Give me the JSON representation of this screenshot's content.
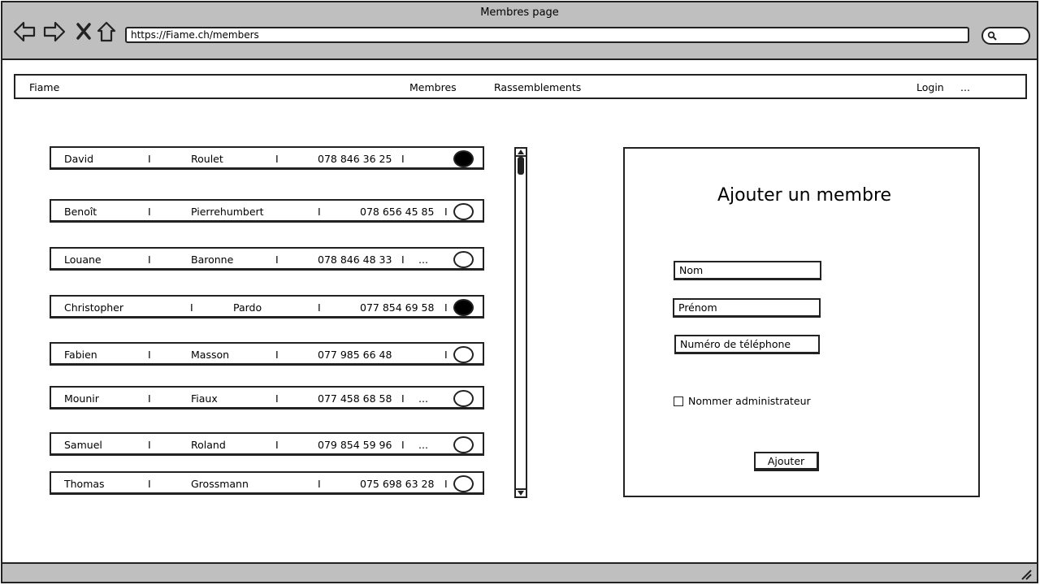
{
  "window": {
    "title": "Membres page"
  },
  "browser": {
    "back_icon": "back-arrow-icon",
    "forward_icon": "forward-arrow-icon",
    "stop_icon": "close-x-icon",
    "home_icon": "home-icon",
    "url": "https://Fiame.ch/members",
    "search_icon": "search-icon"
  },
  "menu": {
    "brand": "Fiame",
    "members": "Membres",
    "gatherings": "Rassemblements",
    "login": "Login",
    "more": "..."
  },
  "members": [
    {
      "first": "David",
      "last": "Roulet",
      "phone": "078 846 36 25",
      "extra": "",
      "admin": true
    },
    {
      "first": "Benoît",
      "last": "Pierrehumbert",
      "phone": "078 656 45 85",
      "extra": "",
      "admin": false
    },
    {
      "first": "Louane",
      "last": "Baronne",
      "phone": "078 846 48 33",
      "extra": "...",
      "admin": false
    },
    {
      "first": "Christopher",
      "last": "Pardo",
      "phone": "077 854 69 58",
      "extra": "",
      "admin": true
    },
    {
      "first": "Fabien",
      "last": "Masson",
      "phone": "077 985 66 48",
      "extra": "",
      "admin": false
    },
    {
      "first": "Mounir",
      "last": "Fiaux",
      "phone": "077 458 68 58",
      "extra": "...",
      "admin": false
    },
    {
      "first": "Samuel",
      "last": "Roland",
      "phone": "079 854 59 96",
      "extra": "...",
      "admin": false
    },
    {
      "first": "Thomas",
      "last": "Grossmann",
      "phone": "075 698 63 28",
      "extra": "",
      "admin": false
    }
  ],
  "separator": "I",
  "form": {
    "title": "Ajouter un membre",
    "last_name_placeholder": "Nom",
    "first_name_placeholder": "Prénom",
    "phone_placeholder": "Numéro de téléphone",
    "admin_label": "Nommer administrateur",
    "submit_label": "Ajouter"
  }
}
